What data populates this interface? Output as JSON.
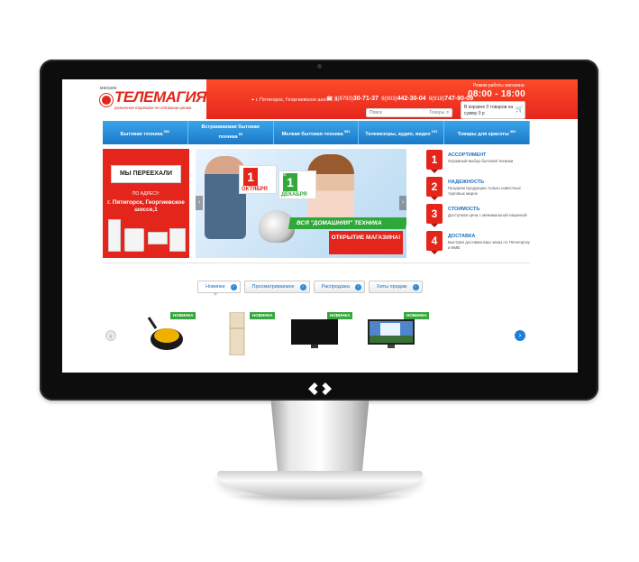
{
  "header": {
    "logo_small": "магазин",
    "logo": "ТЕЛЕМАГИЯ",
    "logo_tagline": "розничная торговля по оптовым ценам",
    "address": "г. Пятигорск, Георгиевское шоссе, 1",
    "phones": [
      {
        "code": "8(8793)",
        "number": "30-71-37"
      },
      {
        "code": "8(903)",
        "number": "442-30-04"
      },
      {
        "code": "8(918)",
        "number": "747-90-09"
      }
    ],
    "hours_label": "Режим работы магазина:",
    "hours": "08:00 - 18:00",
    "search_placeholder": "Поиск",
    "search_select": "Товары",
    "cart_text": "В корзине 0 товаров на сумму 0 р"
  },
  "nav": [
    {
      "label": "Бытовая техника",
      "count": "382"
    },
    {
      "label": "Встраиваемая бытовая техника",
      "count": "89"
    },
    {
      "label": "Мелкая бытовая техника",
      "count": "391"
    },
    {
      "label": "Телевизоры, аудио, видео",
      "count": "191"
    },
    {
      "label": "Товары для красоты",
      "count": "402"
    }
  ],
  "promo": {
    "sign": "МЫ ПЕРЕЕХАЛИ",
    "addr_label": "ПО АДРЕСУ:",
    "address": "г. Пятигорск, Георгиевское шоссе,1"
  },
  "slider": {
    "cal1_num": "1",
    "cal1_month": "ОКТЯБРЯ",
    "cal2_num": "1",
    "cal2_month": "ДЕКАБРЯ",
    "cal_prefix": "с",
    "cal2_prefix": "по",
    "green_banner": "ВСЯ \"ДОМАШНЯЯ\" ТЕХНИКА",
    "red_banner": "ОТКРЫТИЕ МАГАЗИНА!"
  },
  "features": [
    {
      "num": "1",
      "title": "АССОРТИМЕНТ",
      "desc": "Огромный выбор бытовой техники"
    },
    {
      "num": "2",
      "title": "НАДЕЖНОСТЬ",
      "desc": "Продаем продукцию только известных торговых марок"
    },
    {
      "num": "3",
      "title": "СТОИМОСТЬ",
      "desc": "Доступная цена с минимальной наценкой"
    },
    {
      "num": "4",
      "title": "ДОСТАВКА",
      "desc": "Быстрая доставка ваш заказ по Пятигорску и КМВ"
    }
  ],
  "tabs": [
    "Новинки",
    "Просматриваемое",
    "Распродажа",
    "Хиты продаж"
  ],
  "products": {
    "badge": "НОВИНКА",
    "items": [
      "vacuum-cleaner",
      "refrigerator",
      "tv",
      "tv-waterfall"
    ]
  },
  "colors": {
    "brand_red": "#e4251b",
    "nav_blue": "#1b79c8",
    "badge_green": "#36a83b"
  }
}
